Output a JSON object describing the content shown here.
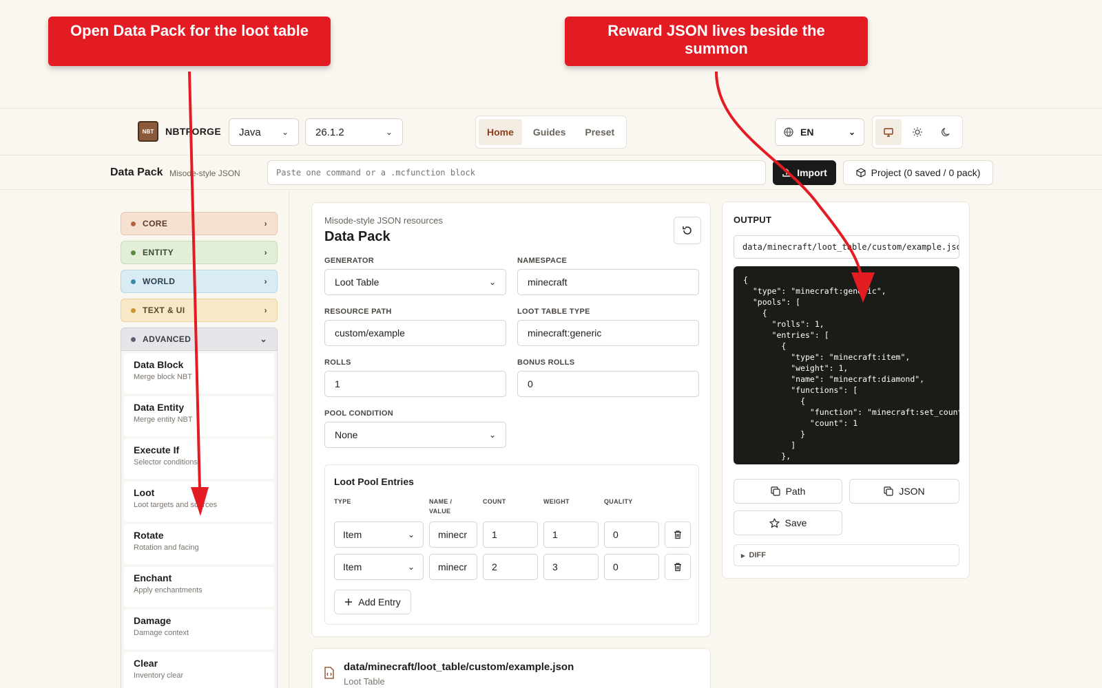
{
  "annotations": {
    "callout_left": "Open Data Pack for the loot table",
    "callout_right": "Reward JSON lives beside the summon"
  },
  "topnav": {
    "logo_text": "NBT",
    "brand": "NBTFORGE",
    "edition_select": "Java",
    "version_select": "26.1.2",
    "tabs": [
      {
        "label": "Home",
        "active": true
      },
      {
        "label": "Guides",
        "active": false
      },
      {
        "label": "Preset",
        "active": false
      }
    ],
    "language": "EN",
    "theme_modes": [
      "monitor-icon",
      "sun-icon",
      "moon-icon"
    ],
    "active_theme": "monitor-icon"
  },
  "subheader": {
    "title": "Data Pack",
    "description": "Misode-style JSON",
    "paste_placeholder": "Paste one command or a .mcfunction block",
    "import_label": "Import",
    "project_label": "Project (0 saved / 0 pack)"
  },
  "sidebar": {
    "categories": [
      {
        "label": "CORE",
        "expanded": false
      },
      {
        "label": "ENTITY",
        "expanded": false
      },
      {
        "label": "WORLD",
        "expanded": false
      },
      {
        "label": "TEXT & UI",
        "expanded": false
      },
      {
        "label": "ADVANCED",
        "expanded": true
      }
    ],
    "advanced_items": [
      {
        "title": "Data Block",
        "desc": "Merge block NBT"
      },
      {
        "title": "Data Entity",
        "desc": "Merge entity NBT"
      },
      {
        "title": "Execute If",
        "desc": "Selector conditions"
      },
      {
        "title": "Loot",
        "desc": "Loot targets and sources"
      },
      {
        "title": "Rotate",
        "desc": "Rotation and facing"
      },
      {
        "title": "Enchant",
        "desc": "Apply enchantments"
      },
      {
        "title": "Damage",
        "desc": "Damage context"
      },
      {
        "title": "Clear",
        "desc": "Inventory clear"
      }
    ]
  },
  "main": {
    "subtitle": "Misode-style JSON resources",
    "title": "Data Pack",
    "fields": {
      "generator_label": "GENERATOR",
      "generator_value": "Loot Table",
      "namespace_label": "NAMESPACE",
      "namespace_value": "minecraft",
      "resource_path_label": "RESOURCE PATH",
      "resource_path_value": "custom/example",
      "loot_table_type_label": "LOOT TABLE TYPE",
      "loot_table_type_value": "minecraft:generic",
      "rolls_label": "ROLLS",
      "rolls_value": "1",
      "bonus_rolls_label": "BONUS ROLLS",
      "bonus_rolls_value": "0",
      "pool_condition_label": "POOL CONDITION",
      "pool_condition_value": "None"
    },
    "entries": {
      "title": "Loot Pool Entries",
      "columns": [
        "TYPE",
        "NAME / VALUE",
        "COUNT",
        "WEIGHT",
        "QUALITY"
      ],
      "rows": [
        {
          "type": "Item",
          "name": "minecr",
          "count": "1",
          "weight": "1",
          "quality": "0"
        },
        {
          "type": "Item",
          "name": "minecr",
          "count": "2",
          "weight": "3",
          "quality": "0"
        }
      ],
      "add_label": "Add Entry"
    },
    "file": {
      "path": "data/minecraft/loot_table/custom/example.json",
      "type": "Loot Table"
    }
  },
  "output": {
    "title": "OUTPUT",
    "path": "data/minecraft/loot_table/custom/example.json",
    "json_text": "{\n  \"type\": \"minecraft:generic\",\n  \"pools\": [\n    {\n      \"rolls\": 1,\n      \"entries\": [\n        {\n          \"type\": \"minecraft:item\",\n          \"weight\": 1,\n          \"name\": \"minecraft:diamond\",\n          \"functions\": [\n            {\n              \"function\": \"minecraft:set_count\",\n              \"count\": 1\n            }\n          ]\n        },",
    "copy_path_label": "Path",
    "copy_json_label": "JSON",
    "save_label": "Save",
    "diff_label": "DIFF"
  },
  "colors": {
    "callout": "#e31b23",
    "accent": "#8a3f1a",
    "code_bg": "#1b1b17"
  }
}
